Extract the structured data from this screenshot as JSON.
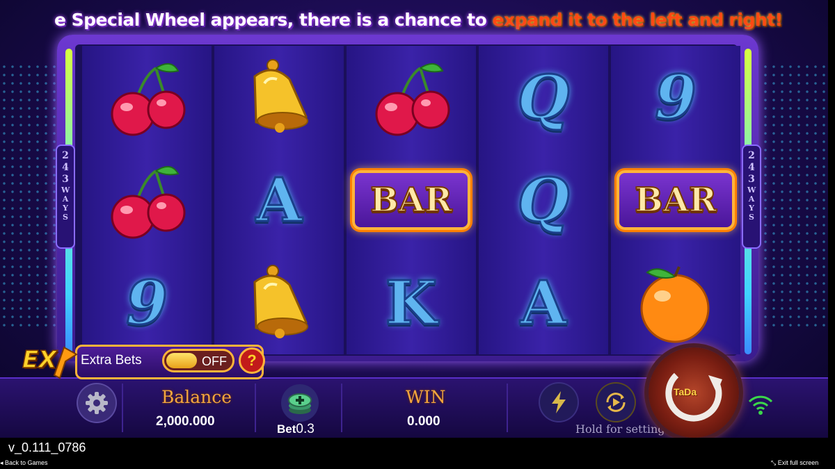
{
  "ticker": {
    "text_white": "e Special Wheel appears, there is a chance to ",
    "text_highlight": "expand it to the left and right!"
  },
  "ways_badge": {
    "number": "243",
    "label": "WAYS"
  },
  "reels": [
    [
      "cherry",
      "cherry",
      "9"
    ],
    [
      "bell",
      "A",
      "bell"
    ],
    [
      "cherry",
      "BAR",
      "K"
    ],
    [
      "Q",
      "Q",
      "A"
    ],
    [
      "9",
      "BAR",
      "orange"
    ]
  ],
  "extra_bets": {
    "badge": "EX",
    "label": "Extra Bets",
    "toggle": "OFF",
    "help": "?"
  },
  "balance": {
    "label": "Balance",
    "value": "2,000.000"
  },
  "bet": {
    "label": "Bet",
    "value": "0.3"
  },
  "win": {
    "label": "WIN",
    "value": "0.000"
  },
  "hold_hint": "Hold for setting",
  "spin_logo": "TaDa",
  "version": "v_0.111_0786",
  "footer": {
    "back": "Back to Games",
    "exit": "Exit full screen"
  },
  "colors": {
    "accent_gold": "#f3a63d",
    "highlight_red": "#ff4a12",
    "reel_bg": "#2f1c98",
    "wifi": "#3bd64a"
  },
  "icons": [
    "settings-gear-icon",
    "chip-stack-icon",
    "lightning-icon",
    "autoplay-icon",
    "wifi-icon",
    "spin-arrow-icon"
  ]
}
